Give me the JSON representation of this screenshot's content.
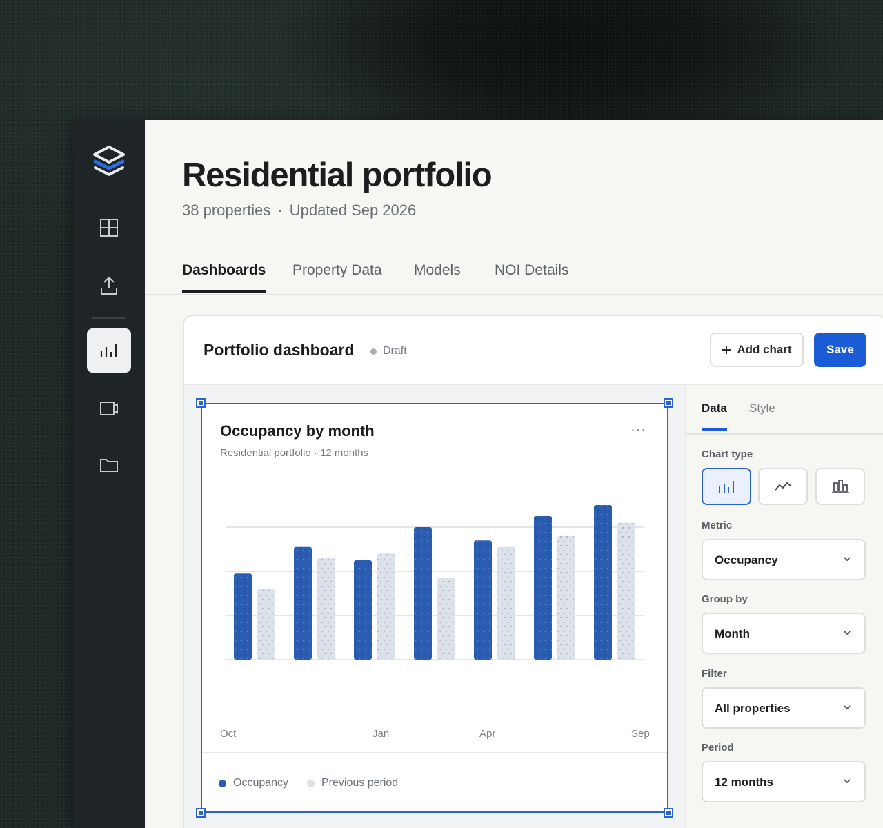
{
  "page": {
    "title": "Residential portfolio",
    "property_count": "38 properties",
    "separator": "·",
    "updated": "Updated Sep 2026"
  },
  "sidebar": {
    "items": [
      {
        "icon": "grid-icon",
        "active": false
      },
      {
        "icon": "upload-icon",
        "active": false
      },
      {
        "icon": "bar-chart-icon",
        "active": true
      },
      {
        "icon": "video-icon",
        "active": false
      },
      {
        "icon": "folder-icon",
        "active": false
      }
    ]
  },
  "tabs": [
    "Dashboards",
    "Property Data",
    "Models",
    "NOI Details"
  ],
  "active_tab": "Dashboards",
  "dashboard": {
    "title": "Portfolio dashboard",
    "status": "Draft",
    "add_chart_label": "Add chart",
    "save_label": "Save"
  },
  "chart_card": {
    "title": "Occupancy by month",
    "subtitle": "Residential portfolio · 12 months",
    "more": "···"
  },
  "chart_data": {
    "type": "bar",
    "categories": [
      "1",
      "2",
      "3",
      "4",
      "5",
      "6",
      "7"
    ],
    "x_tick_labels": [
      "Oct",
      "Jan",
      "Apr",
      "Sep"
    ],
    "series": [
      {
        "name": "Occupancy",
        "color": "#2a5db0",
        "values": [
          3.9,
          5.1,
          4.5,
          6.0,
          5.4,
          6.5,
          7.0
        ]
      },
      {
        "name": "Previous period",
        "color": "#dde2ea",
        "values": [
          3.2,
          4.6,
          4.8,
          3.7,
          5.1,
          5.6,
          6.2
        ]
      }
    ],
    "ylim": [
      0,
      8
    ],
    "grid": true,
    "legend": "bottom-left"
  },
  "panel": {
    "tabs": [
      "Data",
      "Style"
    ],
    "active_tab": "Data",
    "chart_type_label": "Chart type",
    "chart_types": [
      "bar-chart-icon",
      "line-chart-icon",
      "column-chart-icon"
    ],
    "fields": [
      {
        "label": "Metric",
        "value": "Occupancy"
      },
      {
        "label": "Group by",
        "value": "Month"
      },
      {
        "label": "Filter",
        "value": "All properties"
      },
      {
        "label": "Period",
        "value": "12 months"
      }
    ]
  },
  "colors": {
    "accent": "#1b5bd6",
    "sidebar_bg": "#1f2426",
    "page_bg": "#f6f6f3"
  }
}
